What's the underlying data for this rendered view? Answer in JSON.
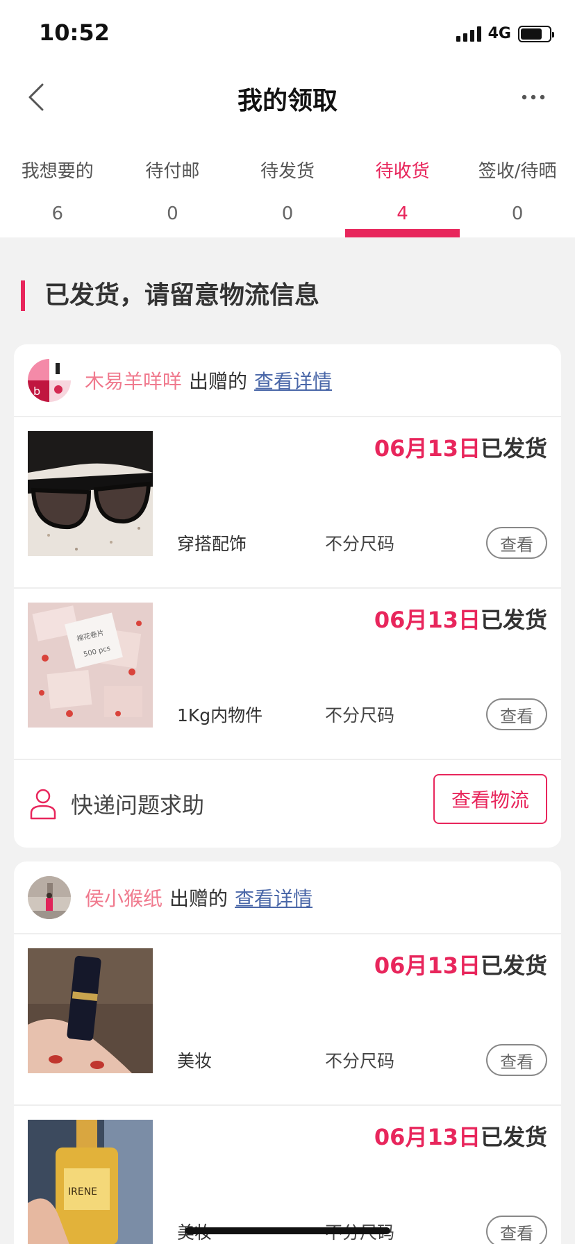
{
  "status_bar": {
    "time": "10:52",
    "network": "4G"
  },
  "nav": {
    "title": "我的领取"
  },
  "tabs": [
    {
      "label": "我想要的",
      "count": "6"
    },
    {
      "label": "待付邮",
      "count": "0"
    },
    {
      "label": "待发货",
      "count": "0"
    },
    {
      "label": "待收货",
      "count": "4"
    },
    {
      "label": "签收/待晒",
      "count": "0"
    }
  ],
  "active_tab_index": 3,
  "section": {
    "title": "已发货，请留意物流信息"
  },
  "cards": [
    {
      "giver": "木易羊咩咩",
      "suffix": "出赠的",
      "details_link": "查看详情",
      "items": [
        {
          "date": "06月13日",
          "status": "已发货",
          "category": "穿搭配饰",
          "size": "不分尺码",
          "view_label": "查看"
        },
        {
          "date": "06月13日",
          "status": "已发货",
          "category": "1Kg内物件",
          "size": "不分尺码",
          "view_label": "查看"
        }
      ],
      "footer": {
        "help_text": "快递问题求助",
        "logistics_label": "查看物流"
      }
    },
    {
      "giver": "侯小猴纸",
      "suffix": "出赠的",
      "details_link": "查看详情",
      "items": [
        {
          "date": "06月13日",
          "status": "已发货",
          "category": "美妆",
          "size": "不分尺码",
          "view_label": "查看"
        },
        {
          "date": "06月13日",
          "status": "已发货",
          "category": "美妆",
          "size": "不分尺码",
          "view_label": "查看"
        }
      ]
    }
  ],
  "colors": {
    "accent": "#e8265c",
    "link": "#4a67a8",
    "giver_name": "#f07a8e"
  },
  "icons": [
    "back-chevron-icon",
    "more-dots-icon",
    "person-outline-icon",
    "signal-icon",
    "battery-icon"
  ]
}
